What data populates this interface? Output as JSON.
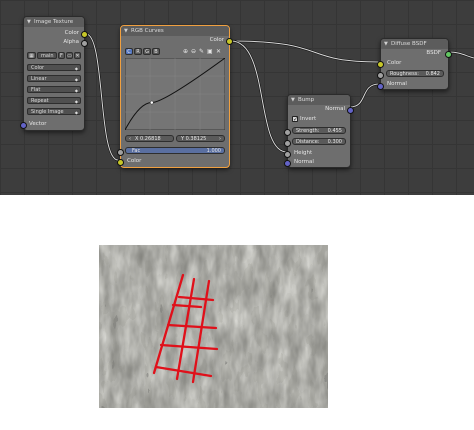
{
  "image_texture": {
    "title": "Image Texture",
    "out_color": "Color",
    "out_alpha": "Alpha",
    "image_name": "main",
    "image_fake_user": "F",
    "color_space": "Color",
    "interpolation": "Linear",
    "projection": "Flat",
    "extension": "Repeat",
    "source": "Single Image",
    "in_vector": "Vector"
  },
  "rgb_curves": {
    "title": "RGB Curves",
    "out_color": "Color",
    "channels": [
      "C",
      "R",
      "G",
      "B"
    ],
    "x_value": "X 0.26818",
    "y_value": "Y 0.38125",
    "fac_label": "Fac",
    "fac_value": "1.000",
    "in_color": "Color",
    "curve_points": [
      [
        0,
        0
      ],
      [
        0.26818,
        0.38125
      ],
      [
        1,
        1
      ]
    ]
  },
  "bump": {
    "title": "Bump",
    "out_normal": "Normal",
    "invert_label": "Invert",
    "invert_checked": true,
    "strength_label": "Strength:",
    "strength_value": "0.455",
    "distance_label": "Distance:",
    "distance_value": "0.300",
    "in_height": "Height",
    "in_normal": "Normal"
  },
  "diffuse": {
    "title": "Diffuse BSDF",
    "out_bsdf": "BSDF",
    "in_color": "Color",
    "roughness_label": "Roughness:",
    "roughness_value": "0.842",
    "in_normal": "Normal"
  },
  "colors": {
    "socket_color": "#c7c729",
    "socket_float": "#a1a1a1",
    "socket_vector": "#6363c7",
    "overlay_grid": "#e0101a"
  },
  "photo": {
    "subject": "grayscale bump texture with red grid overlay"
  }
}
